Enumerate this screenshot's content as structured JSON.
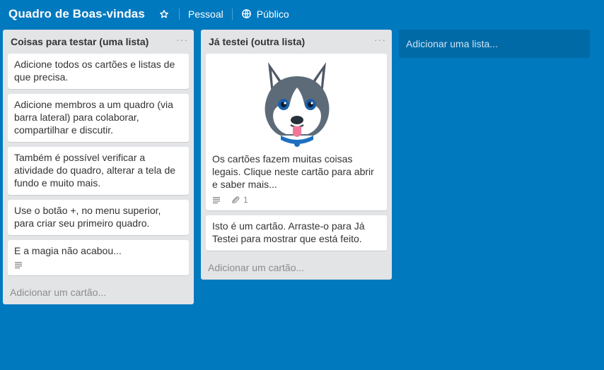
{
  "header": {
    "board_title": "Quadro de Boas-vindas",
    "team_label": "Pessoal",
    "visibility_label": "Público"
  },
  "lists": [
    {
      "title": "Coisas para testar (uma lista)",
      "menu": "···",
      "cards": [
        {
          "text": "Adicione todos os cartões e listas de que precisa."
        },
        {
          "text": "Adicione membros a um quadro (via barra lateral) para colaborar, compartilhar e discutir."
        },
        {
          "text": "Também é possível verificar a atividade do quadro, alterar a tela de fundo e muito mais."
        },
        {
          "text": "Use o botão +, no menu superior, para criar seu primeiro quadro."
        },
        {
          "text": "E a magia não acabou..."
        }
      ],
      "add_card_label": "Adicionar um cartão..."
    },
    {
      "title": "Já testei (outra lista)",
      "menu": "···",
      "cards": [
        {
          "text": "Os cartões fazem muitas coisas legais. Clique neste cartão para abrir e saber mais...",
          "attachments": "1"
        },
        {
          "text": "Isto é um cartão. Arraste-o para Já Testei para mostrar que está feito."
        }
      ],
      "add_card_label": "Adicionar um cartão..."
    }
  ],
  "add_list_label": "Adicionar uma lista...",
  "colors": {
    "board_bg": "#0079bf",
    "list_bg": "#e2e4e6",
    "card_bg": "#ffffff",
    "badge_gray": "#8c8c8c"
  }
}
